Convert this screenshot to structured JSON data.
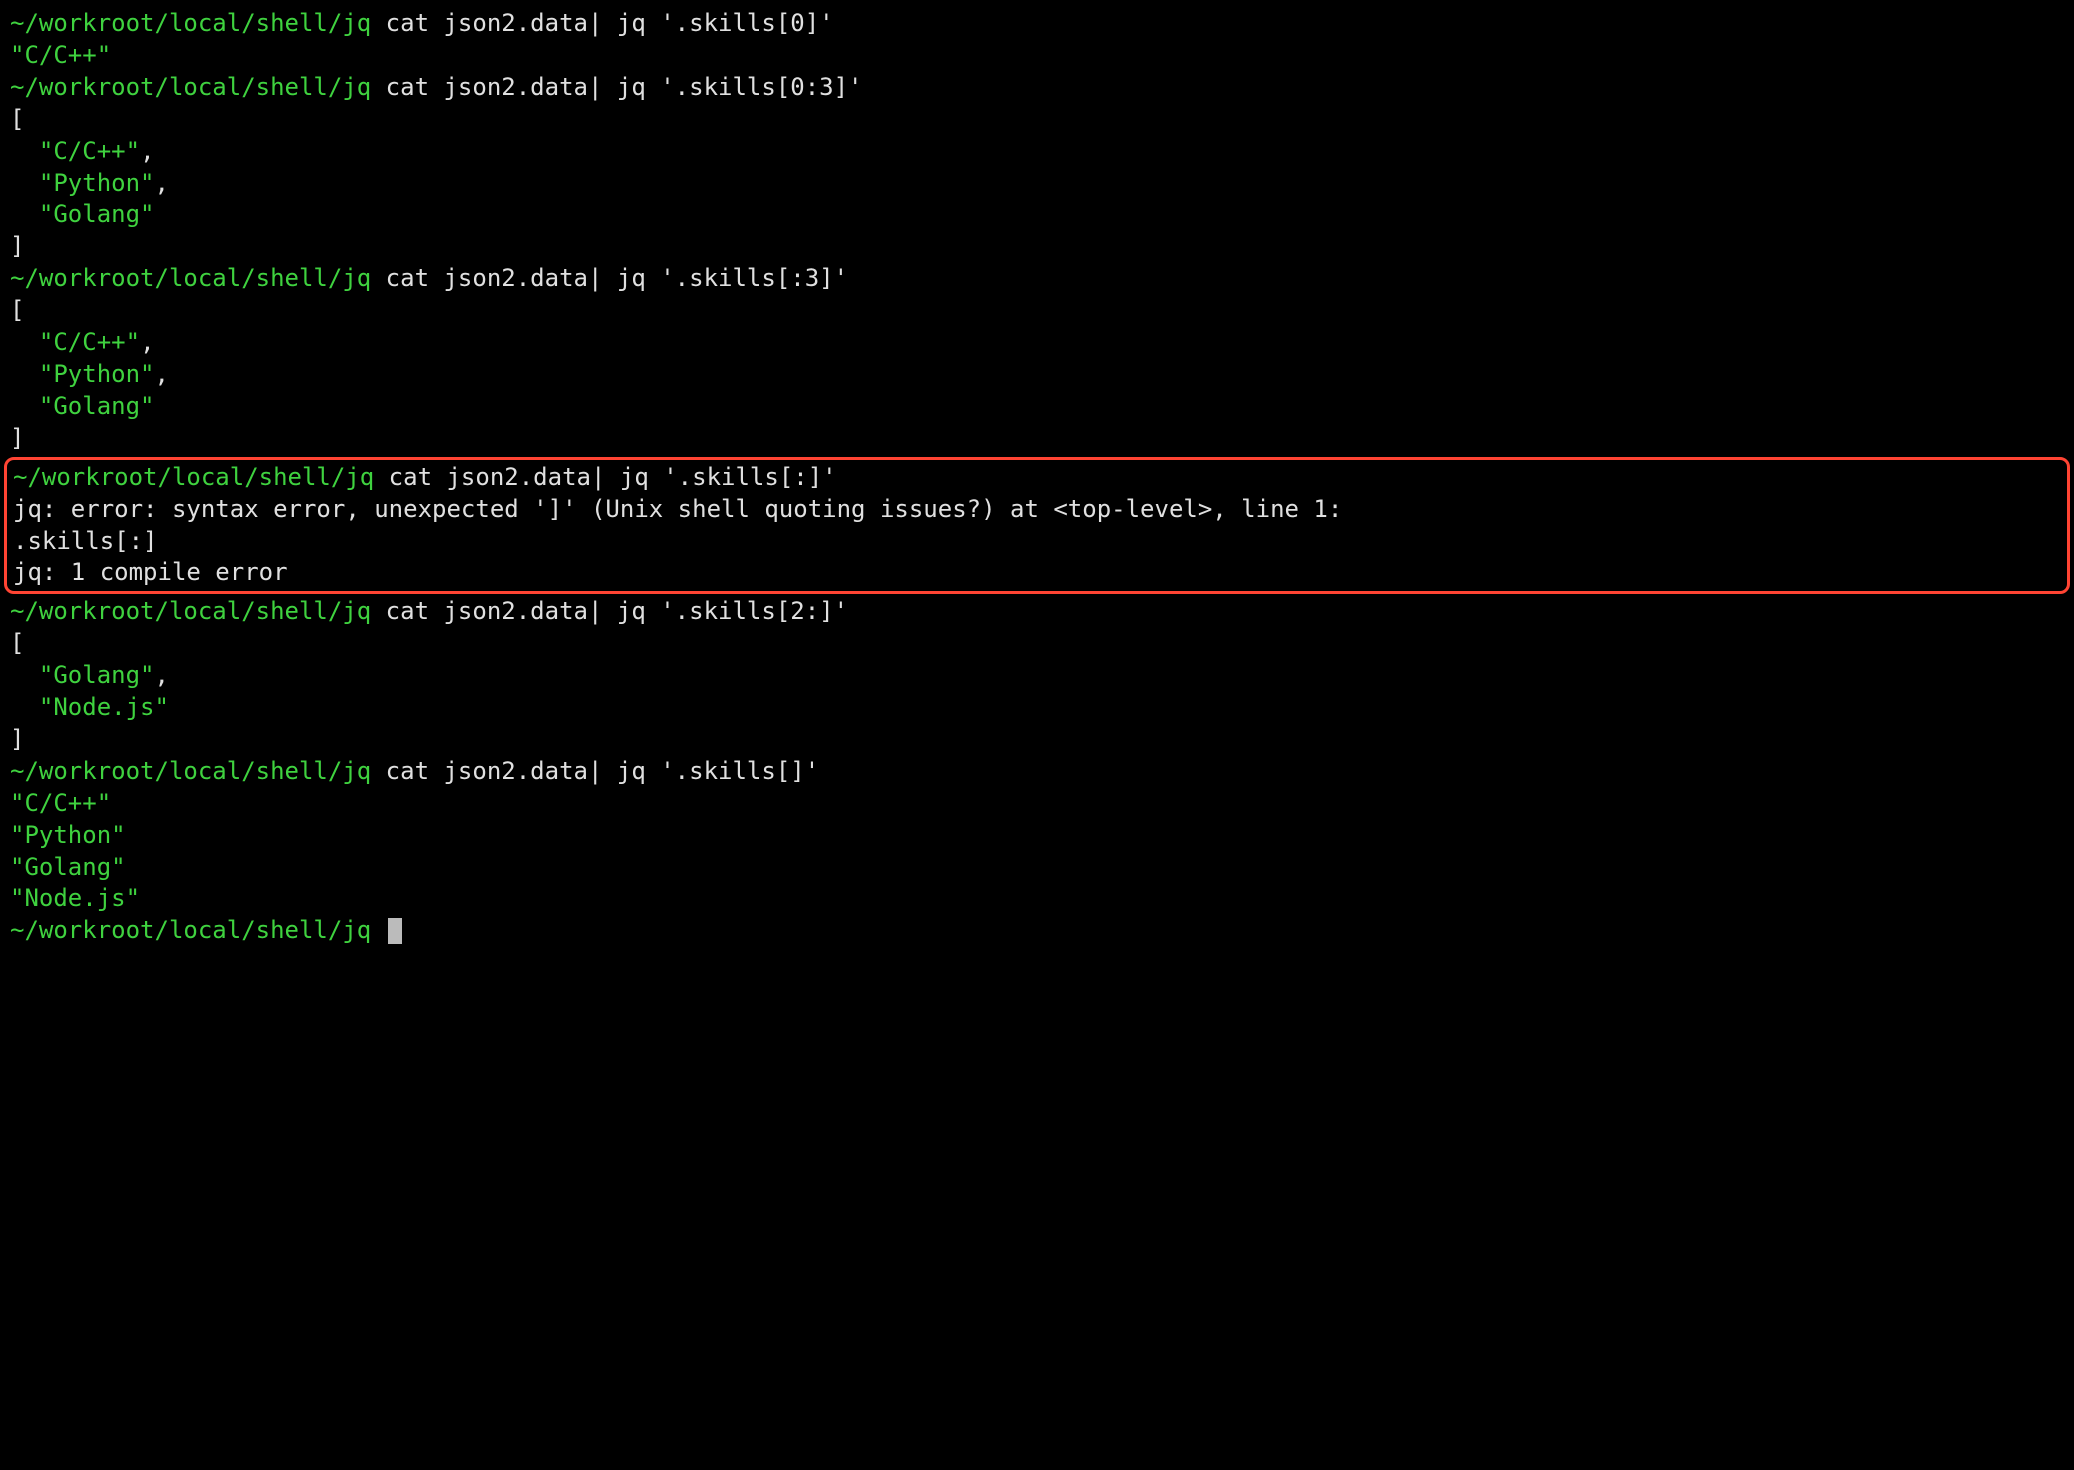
{
  "prompt": "~/workroot/local/shell/jq",
  "blocks": [
    {
      "type": "cmd_output",
      "command": " cat json2.data| jq '.skills[0]'",
      "output": [
        {
          "style": "green",
          "text": "\"C/C++\""
        }
      ]
    },
    {
      "type": "cmd_output",
      "command": " cat json2.data| jq '.skills[0:3]'",
      "output": [
        {
          "style": "white",
          "text": "["
        },
        {
          "style": "green",
          "text": "  \"C/C++\"",
          "suffix": ","
        },
        {
          "style": "green",
          "text": "  \"Python\"",
          "suffix": ","
        },
        {
          "style": "green",
          "text": "  \"Golang\""
        },
        {
          "style": "white",
          "text": "]"
        }
      ]
    },
    {
      "type": "cmd_output",
      "command": " cat json2.data| jq '.skills[:3]'",
      "output": [
        {
          "style": "white",
          "text": "["
        },
        {
          "style": "green",
          "text": "  \"C/C++\"",
          "suffix": ","
        },
        {
          "style": "green",
          "text": "  \"Python\"",
          "suffix": ","
        },
        {
          "style": "green",
          "text": "  \"Golang\""
        },
        {
          "style": "white",
          "text": "]"
        }
      ]
    },
    {
      "type": "highlighted",
      "command": " cat json2.data| jq '.skills[:]'",
      "output": [
        {
          "style": "white",
          "text": "jq: error: syntax error, unexpected ']' (Unix shell quoting issues?) at <top-level>, line 1:"
        },
        {
          "style": "white",
          "text": ".skills[:]"
        },
        {
          "style": "white",
          "text": "jq: 1 compile error"
        }
      ]
    },
    {
      "type": "cmd_output",
      "command": " cat json2.data| jq '.skills[2:]'",
      "output": [
        {
          "style": "white",
          "text": "["
        },
        {
          "style": "green",
          "text": "  \"Golang\"",
          "suffix": ","
        },
        {
          "style": "green",
          "text": "  \"Node.js\""
        },
        {
          "style": "white",
          "text": "]"
        }
      ]
    },
    {
      "type": "cmd_output",
      "command": " cat json2.data| jq '.skills[]'",
      "output": [
        {
          "style": "green",
          "text": "\"C/C++\""
        },
        {
          "style": "green",
          "text": "\"Python\""
        },
        {
          "style": "green",
          "text": "\"Golang\""
        },
        {
          "style": "green",
          "text": "\"Node.js\""
        }
      ]
    },
    {
      "type": "prompt_only"
    }
  ]
}
